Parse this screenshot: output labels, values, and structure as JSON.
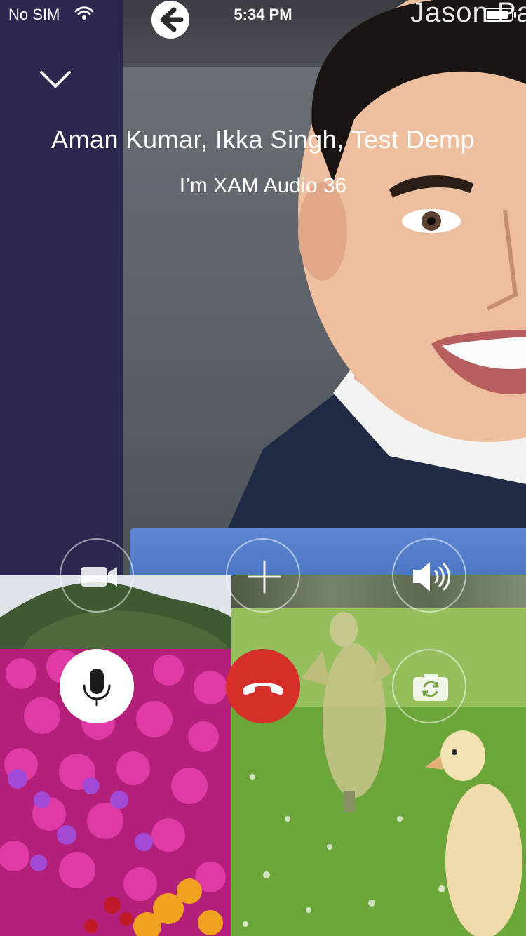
{
  "status_bar": {
    "carrier": "No SIM",
    "time": "5:34 PM"
  },
  "call": {
    "participants": "Aman Kumar, Ikka Singh, Test Demp",
    "subtitle": "I’m XAM Audio 36",
    "remote_video_name": "Jason Pa"
  },
  "controls": {
    "video": "video-camera-icon",
    "add": "plus-icon",
    "speaker": "speaker-icon",
    "mute": "microphone-icon",
    "end": "end-call-icon",
    "flip": "camera-flip-icon"
  },
  "colors": {
    "left_panel": "#2b2850",
    "end_call": "#d62f2a",
    "mic_bg": "#ffffff"
  }
}
